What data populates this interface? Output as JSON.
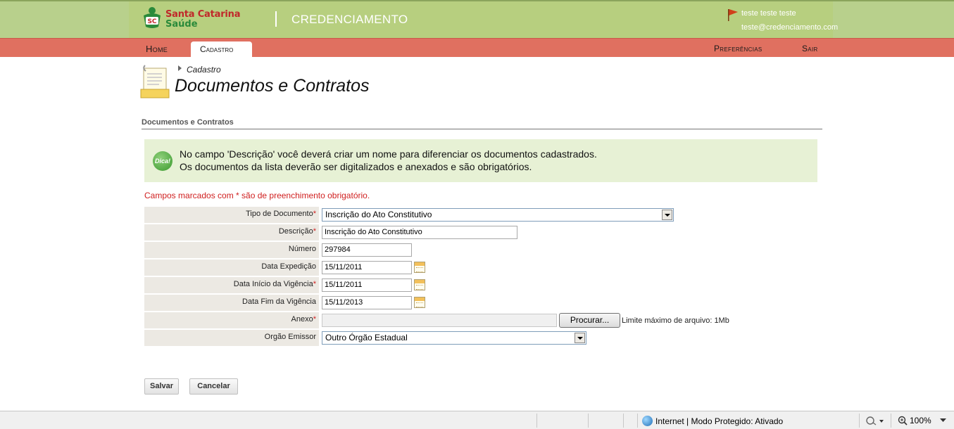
{
  "header": {
    "logo_line1": "Santa Catarina",
    "logo_line2": "Saúde",
    "logo_badge": "SC",
    "app_title": "CREDENCIAMENTO",
    "user_name": "teste teste teste",
    "user_email": "teste@credenciamento.com"
  },
  "nav": {
    "home": "Home",
    "cadastro": "Cadastro",
    "preferencias": "Preferências",
    "sair": "Sair"
  },
  "page": {
    "breadcrumb": "Cadastro",
    "title": "Documentos e Contratos",
    "section_title": "Documentos e Contratos"
  },
  "tip": {
    "icon_label": "Dica!",
    "line1": "No campo 'Descrição' você deverá criar um nome para diferenciar os documentos cadastrados.",
    "line2": "Os documentos da lista deverão ser digitalizados e anexados e são obrigatórios."
  },
  "required_note": "Campos marcados com * são de preenchimento obrigatório.",
  "form": {
    "tipo_documento": {
      "label": "Tipo de Documento",
      "value": "Inscrição do Ato Constitutivo"
    },
    "descricao": {
      "label": "Descrição",
      "value": "Inscrição do Ato Constitutivo"
    },
    "numero": {
      "label": "Número",
      "value": "297984"
    },
    "data_expedicao": {
      "label": "Data Expedição",
      "value": "15/11/2011"
    },
    "data_inicio": {
      "label": "Data Início da Vigência",
      "value": "15/11/2011"
    },
    "data_fim": {
      "label": "Data Fim da Vigência",
      "value": "15/11/2013"
    },
    "anexo": {
      "label": "Anexo",
      "button": "Procurar...",
      "limit": "Limite máximo de arquivo: 1Mb"
    },
    "orgao_emissor": {
      "label": "Orgão Emissor",
      "value": "Outro Órgão Estadual"
    },
    "required_star": "*"
  },
  "actions": {
    "save": "Salvar",
    "cancel": "Cancelar"
  },
  "statusbar": {
    "zone": "Internet | Modo Protegido: Ativado",
    "zoom": "100%"
  },
  "colors": {
    "header_green": "#b7cf7f",
    "nav_red": "#e07060",
    "tip_bg": "#e7f1d5",
    "required_red": "#d02020"
  }
}
